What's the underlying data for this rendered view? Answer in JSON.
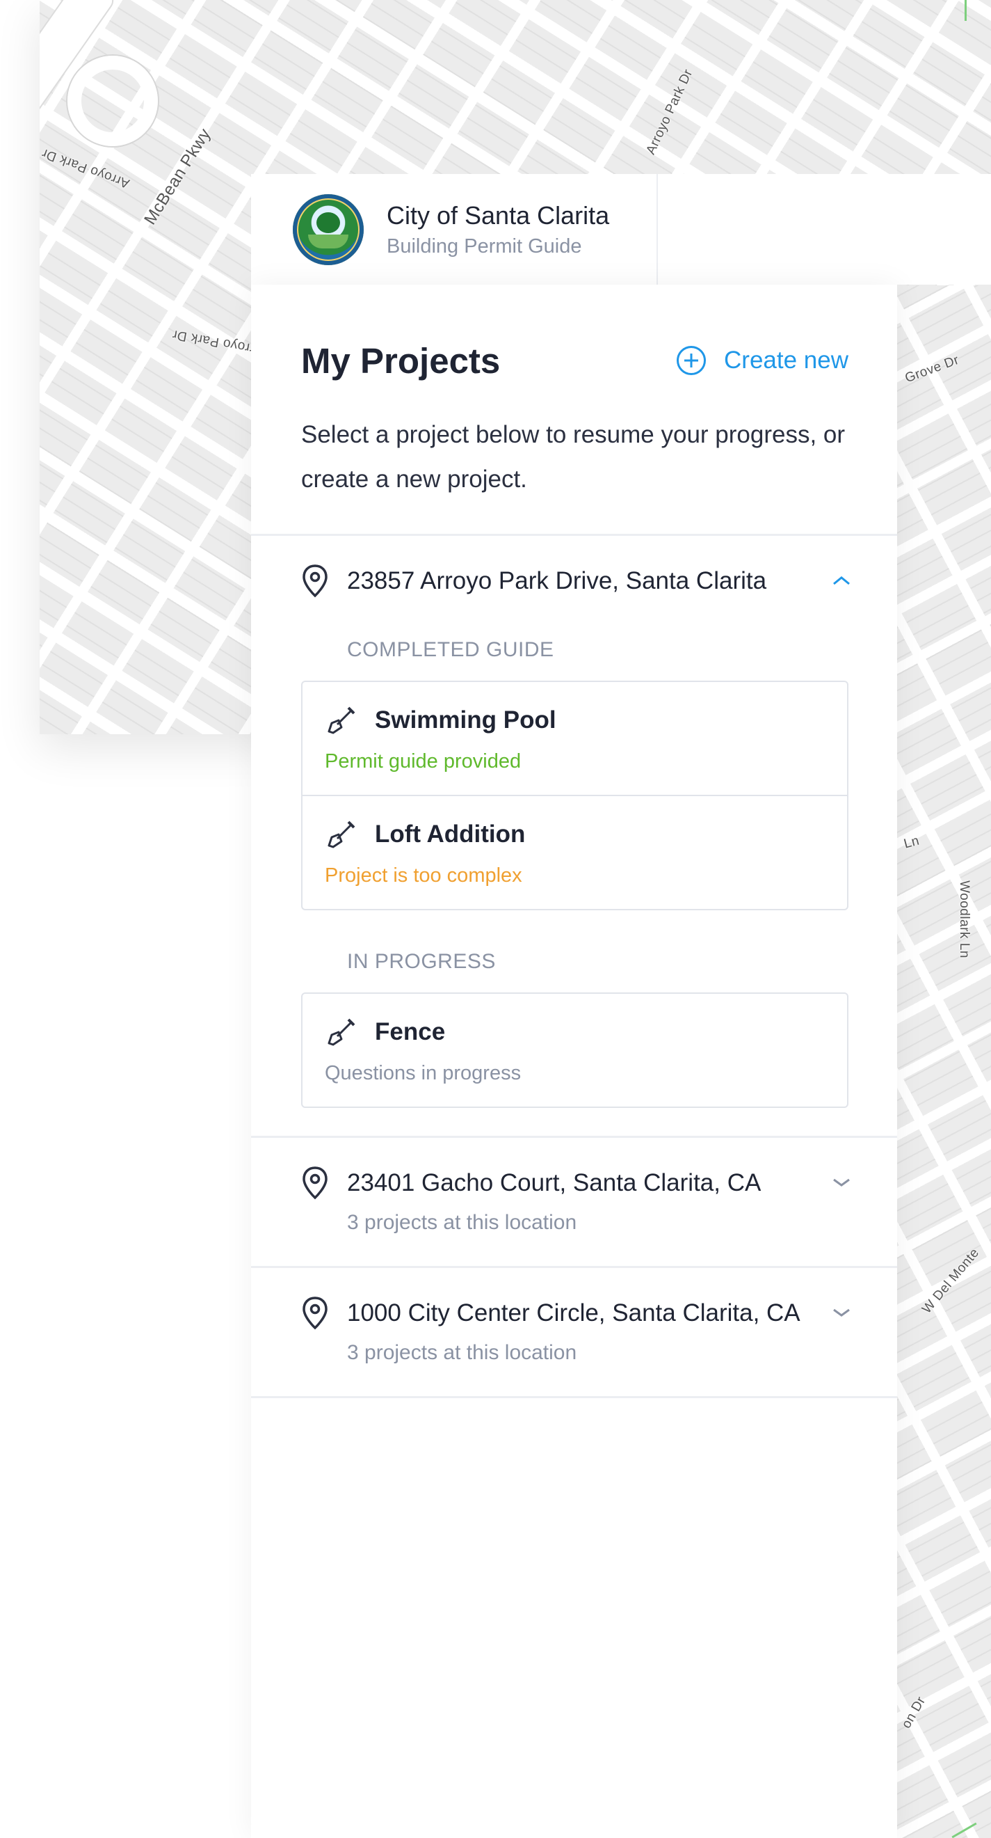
{
  "map": {
    "street_labels": [
      "McBean Pkwy",
      "Arroyo Park Dr",
      "Arroyo Park Dr",
      "Arroyo Park Dr",
      "Grove Dr",
      "Ln",
      "Woodlark Ln",
      "W Del Monte",
      "on Dr"
    ]
  },
  "header": {
    "title": "City of Santa Clarita",
    "subtitle": "Building Permit Guide"
  },
  "panel": {
    "title": "My Projects",
    "create_new_label": "Create new",
    "intro": "Select a project below to resume your progress, or create a new project."
  },
  "locations": [
    {
      "address": "23857 Arroyo Park Drive, Santa Clarita",
      "expanded": true,
      "sections": [
        {
          "label": "COMPLETED GUIDE",
          "items": [
            {
              "name": "Swimming Pool",
              "status": "Permit guide provided",
              "status_color": "#5fb92c"
            },
            {
              "name": "Loft Addition",
              "status": "Project is too complex",
              "status_color": "#f0a030"
            }
          ]
        },
        {
          "label": "IN PROGRESS",
          "items": [
            {
              "name": "Fence",
              "status": "Questions in progress",
              "status_color": "#8a92a3"
            }
          ]
        }
      ]
    },
    {
      "address": "23401 Gacho Court, Santa Clarita, CA",
      "expanded": false,
      "summary": "3 projects at this location"
    },
    {
      "address": "1000 City Center Circle, Santa Clarita, CA",
      "expanded": false,
      "summary": "3 projects at this location"
    }
  ],
  "icons": {
    "location": "map-pin-icon",
    "project": "shovel-icon",
    "expand": "chevron-up-icon",
    "collapse": "chevron-down-icon",
    "create": "plus-circle-icon"
  },
  "colors": {
    "accent": "#1f97e8",
    "success": "#5fb92c",
    "warning": "#f0a030",
    "muted": "#8a92a3"
  }
}
